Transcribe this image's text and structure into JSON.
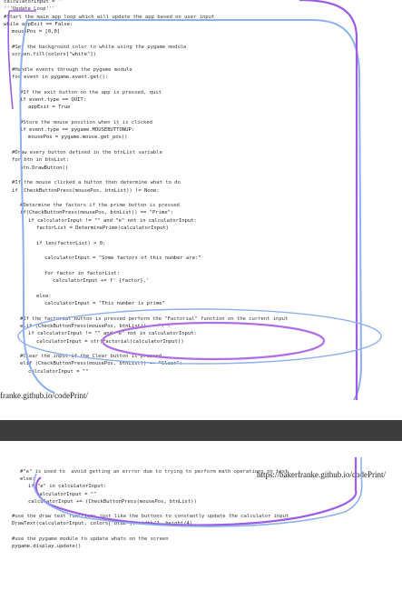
{
  "page1": {
    "lines": [
      {
        "indent": 0,
        "text": "calculatorInput = ''"
      },
      {
        "indent": 0,
        "text": "'''Update Loop'''"
      },
      {
        "indent": 0,
        "text": "#Start the main app loop which will update the app based on user input"
      },
      {
        "indent": 0,
        "text": "while appExit == False:"
      },
      {
        "indent": 1,
        "text": "mousePos = [0,0]"
      },
      {
        "indent": 0,
        "text": ""
      },
      {
        "indent": 1,
        "text": "#Set the background color to white using the pygame module"
      },
      {
        "indent": 1,
        "text": "screen.fill(colors[\"white\"])"
      },
      {
        "indent": 0,
        "text": ""
      },
      {
        "indent": 1,
        "text": "#Handle events through the pygame module"
      },
      {
        "indent": 1,
        "text": "for event in pygame.event.get():"
      },
      {
        "indent": 0,
        "text": ""
      },
      {
        "indent": 2,
        "text": "#If the exit button on the app is pressed, quit"
      },
      {
        "indent": 2,
        "text": "if event.type == QUIT:"
      },
      {
        "indent": 3,
        "text": "appExit = True"
      },
      {
        "indent": 0,
        "text": ""
      },
      {
        "indent": 2,
        "text": "#Store the mouse position when it is clicked"
      },
      {
        "indent": 2,
        "text": "if event.type == pygame.MOUSEBUTTONUP:"
      },
      {
        "indent": 3,
        "text": "mousePos = pygame.mouse.get_pos()"
      },
      {
        "indent": 0,
        "text": ""
      },
      {
        "indent": 1,
        "text": "#Draw every button defined in the btnList variable"
      },
      {
        "indent": 1,
        "text": "for btn in btnList:"
      },
      {
        "indent": 2,
        "text": "btn.DrawButton()"
      },
      {
        "indent": 0,
        "text": ""
      },
      {
        "indent": 1,
        "text": "#If the mouse clicked a button then determine what to do"
      },
      {
        "indent": 1,
        "text": "if (CheckButtonPress(mousePos, btnList)) != None:"
      },
      {
        "indent": 0,
        "text": ""
      },
      {
        "indent": 2,
        "text": "#Determine the factors if the prime button is pressed"
      },
      {
        "indent": 2,
        "text": "if(CheckButtonPress(mousePos, btnList)) == \"Prime\":"
      },
      {
        "indent": 3,
        "text": "if calculatorInput != \"\" and \"e\" not in calculatorInput:"
      },
      {
        "indent": 4,
        "text": "factorList = DeterminePrime(calculatorInput)"
      },
      {
        "indent": 0,
        "text": ""
      },
      {
        "indent": 4,
        "text": "if len(factorList) > 0:"
      },
      {
        "indent": 0,
        "text": ""
      },
      {
        "indent": 5,
        "text": "calculatorInput = \"Some factors of this number are:\""
      },
      {
        "indent": 0,
        "text": ""
      },
      {
        "indent": 5,
        "text": "for factor in factorList:"
      },
      {
        "indent": 6,
        "text": "calculatorInput += f' {factor},'"
      },
      {
        "indent": 0,
        "text": ""
      },
      {
        "indent": 4,
        "text": "else:"
      },
      {
        "indent": 5,
        "text": "calculatorInput = \"This number is prime\""
      },
      {
        "indent": 0,
        "text": ""
      },
      {
        "indent": 2,
        "text": "#If the factorial button is pressed perform the \"Factorial\" function on the current input"
      },
      {
        "indent": 2,
        "text": "elif (CheckButtonPress(mousePos, btnList)) == \"!\":"
      },
      {
        "indent": 3,
        "text": "if calculatorInput != \"\" and \"e\" not in calculatorInput:"
      },
      {
        "indent": 4,
        "text": "calculatorInput = str(Factorial(calculatorInput))"
      },
      {
        "indent": 0,
        "text": ""
      },
      {
        "indent": 2,
        "text": "#Clear the input if the Clear button is pressed"
      },
      {
        "indent": 2,
        "text": "elif (CheckButtonPress(mousePos, btnList)) == \"Clear\":"
      },
      {
        "indent": 3,
        "text": "calculatorInput = \"\""
      }
    ],
    "footer_url": "franke.github.io/codePrint/"
  },
  "page2": {
    "header_url": "https://bakerfranke.github.io/codePrint/",
    "lines": [
      {
        "indent": 2,
        "text": "#\"e\" is used to  avoid getting an errror due to trying to perform math operations on text"
      },
      {
        "indent": 2,
        "text": "else:"
      },
      {
        "indent": 3,
        "text": "if \"e\" in calculatorInput:"
      },
      {
        "indent": 4,
        "text": "calculatorInput = \"\""
      },
      {
        "indent": 3,
        "text": "calculatorInput += (CheckButtonPress(mousePos, btnList))"
      },
      {
        "indent": 0,
        "text": ""
      },
      {
        "indent": 1,
        "text": "#use the draw text functions just like the buttons to constantly update the calculator input"
      },
      {
        "indent": 1,
        "text": "DrawText(calculatorInput, colors[\"blue\"], width/2, height/4)"
      },
      {
        "indent": 0,
        "text": ""
      },
      {
        "indent": 1,
        "text": "#use the pygame module to update whats on the screen"
      },
      {
        "indent": 1,
        "text": "pygame.display.update()"
      }
    ]
  },
  "colors": {
    "annotation_purple": "#9b5de5",
    "annotation_blue": "#8fb0f0",
    "divider": "#3c3c3c"
  }
}
